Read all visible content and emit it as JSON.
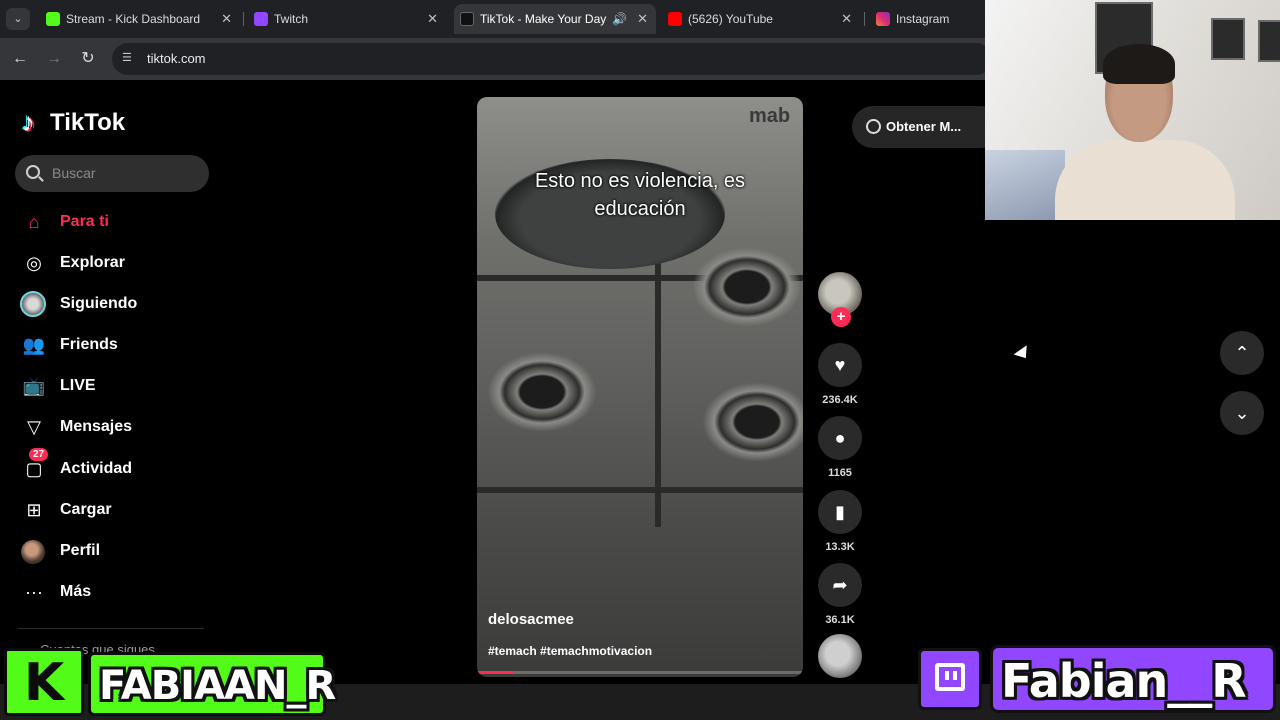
{
  "browser": {
    "tabs": [
      {
        "title": "Stream - Kick Dashboard",
        "favicon": "kick-icon",
        "color": "#53fc18",
        "active": false
      },
      {
        "title": "Twitch",
        "favicon": "twitch-icon",
        "color": "#9146ff",
        "active": false
      },
      {
        "title": "TikTok - Make Your Day",
        "favicon": "tiktok-icon",
        "color": "#ffffff",
        "active": true,
        "audio": true
      },
      {
        "title": "(5626) YouTube",
        "favicon": "youtube-icon",
        "color": "#ff0000",
        "active": false
      },
      {
        "title": "Instagram",
        "favicon": "instagram-icon",
        "color": "#e1306c",
        "active": false
      }
    ],
    "url": "tiktok.com"
  },
  "tiktok": {
    "logo_text": "TikTok",
    "search_placeholder": "Buscar",
    "nav": [
      {
        "label": "Para ti",
        "icon": "home-icon",
        "active": true
      },
      {
        "label": "Explorar",
        "icon": "compass-icon"
      },
      {
        "label": "Siguiendo",
        "icon": "following-avatar-icon"
      },
      {
        "label": "Friends",
        "icon": "friends-icon"
      },
      {
        "label": "LIVE",
        "icon": "live-tv-icon"
      },
      {
        "label": "Mensajes",
        "icon": "send-icon"
      },
      {
        "label": "Actividad",
        "icon": "activity-icon",
        "badge": "27"
      },
      {
        "label": "Cargar",
        "icon": "upload-icon"
      },
      {
        "label": "Perfil",
        "icon": "profile-avatar-icon"
      },
      {
        "label": "Más",
        "icon": "more-icon"
      }
    ],
    "following_caption": "Cuentas que sigues",
    "get_app_label": "Obtener M...",
    "video": {
      "caption": "Esto no es violencia, es educación",
      "brand_mark": "mab",
      "username": "delosacmee",
      "hashtags": "#temach #temachmotivacion",
      "progress": 0.11
    },
    "actions": {
      "likes": "236.4K",
      "comments": "1165",
      "saves": "13.3K",
      "shares": "36.1K"
    }
  },
  "overlays": {
    "kick_name": "FABIAAN_R",
    "twitch_name": "Fabian__R",
    "kick_color": "#53fc18",
    "twitch_color": "#9146ff"
  }
}
